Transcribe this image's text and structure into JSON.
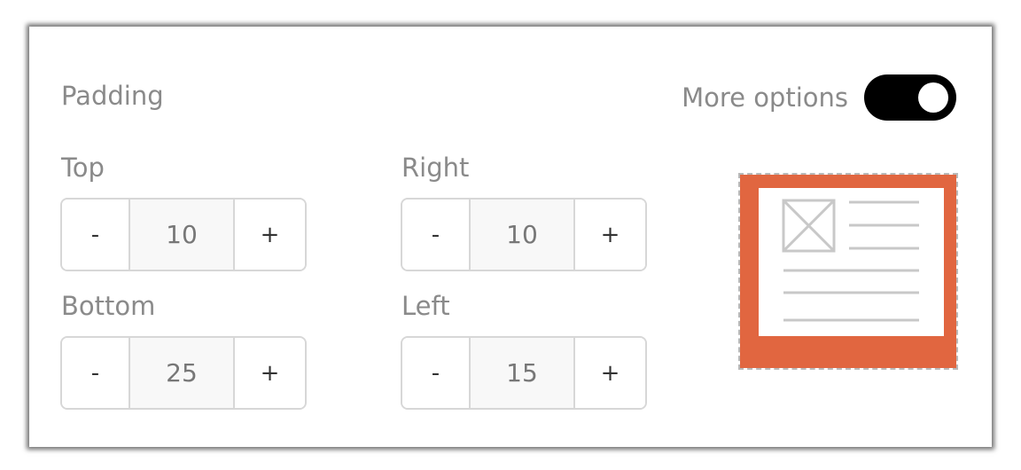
{
  "padding": {
    "title": "Padding",
    "more_options": {
      "label": "More options",
      "enabled": true
    },
    "fields": {
      "top": {
        "label": "Top",
        "value": "10",
        "decrement": "-",
        "increment": "+"
      },
      "right": {
        "label": "Right",
        "value": "10",
        "decrement": "-",
        "increment": "+"
      },
      "bottom": {
        "label": "Bottom",
        "value": "25",
        "decrement": "-",
        "increment": "+"
      },
      "left": {
        "label": "Left",
        "value": "15",
        "decrement": "-",
        "increment": "+"
      }
    }
  },
  "preview": {
    "border_color": "#e16640",
    "line_color": "#c8c8c8",
    "icon": "image-placeholder-icon"
  }
}
